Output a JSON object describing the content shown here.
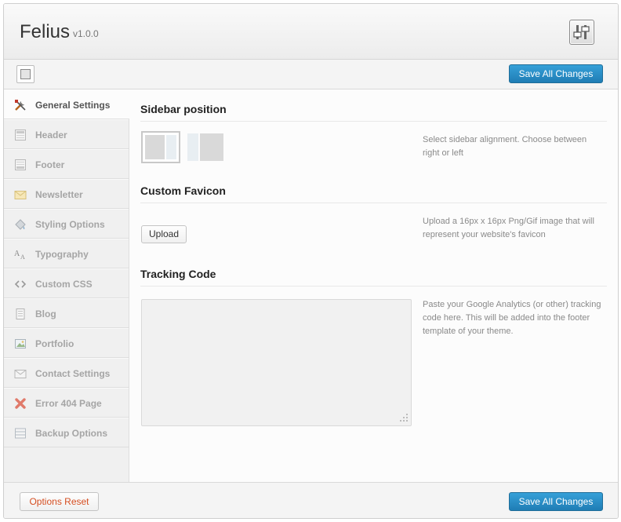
{
  "header": {
    "title": "Felius",
    "version": "v1.0.0"
  },
  "toolbar": {
    "save_label": "Save All Changes"
  },
  "sidebar": {
    "items": [
      {
        "label": "General Settings",
        "icon": "tools-icon",
        "active": true
      },
      {
        "label": "Header",
        "icon": "header-icon"
      },
      {
        "label": "Footer",
        "icon": "footer-icon"
      },
      {
        "label": "Newsletter",
        "icon": "envelope-icon"
      },
      {
        "label": "Styling Options",
        "icon": "paint-bucket-icon"
      },
      {
        "label": "Typography",
        "icon": "typography-icon"
      },
      {
        "label": "Custom CSS",
        "icon": "code-icon"
      },
      {
        "label": "Blog",
        "icon": "document-icon"
      },
      {
        "label": "Portfolio",
        "icon": "image-icon"
      },
      {
        "label": "Contact Settings",
        "icon": "mail-icon"
      },
      {
        "label": "Error 404 Page",
        "icon": "error-x-icon"
      },
      {
        "label": "Backup Options",
        "icon": "backup-icon"
      }
    ]
  },
  "main": {
    "sidebar_position": {
      "title": "Sidebar position",
      "description": "Select sidebar alignment. Choose between right or left"
    },
    "favicon": {
      "title": "Custom Favicon",
      "upload_label": "Upload",
      "description": "Upload a 16px x 16px Png/Gif image that will represent your website's favicon"
    },
    "tracking": {
      "title": "Tracking Code",
      "value": "",
      "description": "Paste your Google Analytics (or other) tracking code here. This will be added into the footer template of your theme."
    }
  },
  "footer": {
    "reset_label": "Options Reset",
    "save_label": "Save All Changes"
  },
  "colors": {
    "accent": "#2a8ac6",
    "reset_text": "#d54e21",
    "active_label": "#555555",
    "inactive_label": "#a5a5a5"
  }
}
